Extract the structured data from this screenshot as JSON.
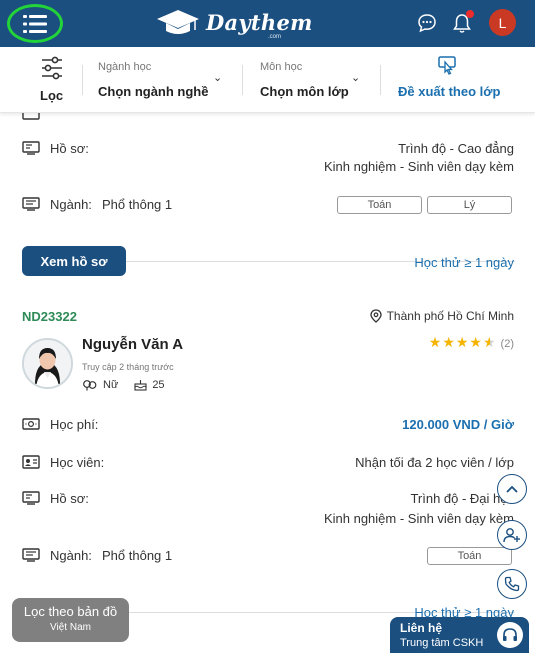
{
  "header": {
    "logo_text": "Daythem",
    "logo_sub": ".com",
    "avatar_letter": "L"
  },
  "filters": {
    "filter_label": "Lọc",
    "major_caption": "Ngành học",
    "major_value": "Chọn ngành nghề",
    "subject_caption": "Môn học",
    "subject_value": "Chọn môn lớp",
    "suggest_label": "Đề xuất theo lớp"
  },
  "card1": {
    "profile_label": "Hồ sơ:",
    "profile_line1": "Trình độ - Cao đẳng",
    "profile_line2": "Kinh nghiệm - Sinh viên dạy kèm",
    "major_label": "Ngành:",
    "major_value": "Phổ thông 1",
    "subjects": [
      "Toán",
      "Lý"
    ],
    "view_button": "Xem hồ sơ",
    "trial": "Học thử ≥ 1 ngày"
  },
  "card2": {
    "id": "ND23322",
    "location": "Thành phố Hồ Chí Minh",
    "name": "Nguyễn Văn A",
    "last_access": "Truy cập 2 tháng trước",
    "gender": "Nữ",
    "age": "25",
    "rating": 4.5,
    "review_count": "(2)",
    "fee_label": "Học phí:",
    "fee_value": "120.000 VND / Giờ",
    "student_label": "Học viên:",
    "student_value": "Nhận tối đa 2 học viên / lớp",
    "profile_label": "Hồ sơ:",
    "profile_line1": "Trình độ - Đại học",
    "profile_line2": "Kinh nghiệm - Sinh viên dạy kèm",
    "major_label": "Ngành:",
    "major_value": "Phổ thông 1",
    "subjects": [
      "Toán"
    ],
    "trial": "Học thử ≥ 1 ngày"
  },
  "floating": {
    "map_title": "Lọc theo bản đồ",
    "map_sub": "Việt Nam",
    "contact_title": "Liên hệ",
    "contact_sub": "Trung tâm CSKH"
  },
  "colors": {
    "primary": "#1b4f80",
    "link": "#1b6fae",
    "id_green": "#2e8b57",
    "star": "#f5b400",
    "highlight_ring": "#22d33a"
  },
  "icons": [
    "menu-icon",
    "graduation-cap-icon",
    "chat-icon",
    "bell-icon",
    "filter-sliders-icon",
    "suggest-icon",
    "chevron-up-icon",
    "add-user-icon",
    "phone-icon",
    "headset-icon",
    "location-pin-icon"
  ]
}
